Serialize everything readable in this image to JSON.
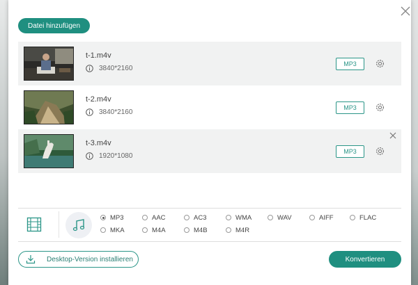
{
  "toolbar": {
    "add_label": "Datei hinzufügen"
  },
  "files": [
    {
      "name": "t-1.m4v",
      "resolution": "3840*2160",
      "format": "MP3"
    },
    {
      "name": "t-2.m4v",
      "resolution": "3840*2160",
      "format": "MP3"
    },
    {
      "name": "t-3.m4v",
      "resolution": "1920*1080",
      "format": "MP3"
    }
  ],
  "formats": {
    "selected": "MP3",
    "options": [
      "MP3",
      "AAC",
      "AC3",
      "WMA",
      "WAV",
      "AIFF",
      "FLAC",
      "MKA",
      "M4A",
      "M4B",
      "M4R"
    ]
  },
  "footer": {
    "desktop_label": "Desktop-Version installieren",
    "convert_label": "Konvertieren"
  },
  "colors": {
    "accent": "#1f8f80",
    "accent_border": "#2a9587"
  },
  "icons": {
    "close": "close-icon",
    "info": "info-icon",
    "settings": "gear-icon",
    "video_tab": "film-icon",
    "audio_tab": "music-note-icon",
    "download": "download-icon"
  }
}
